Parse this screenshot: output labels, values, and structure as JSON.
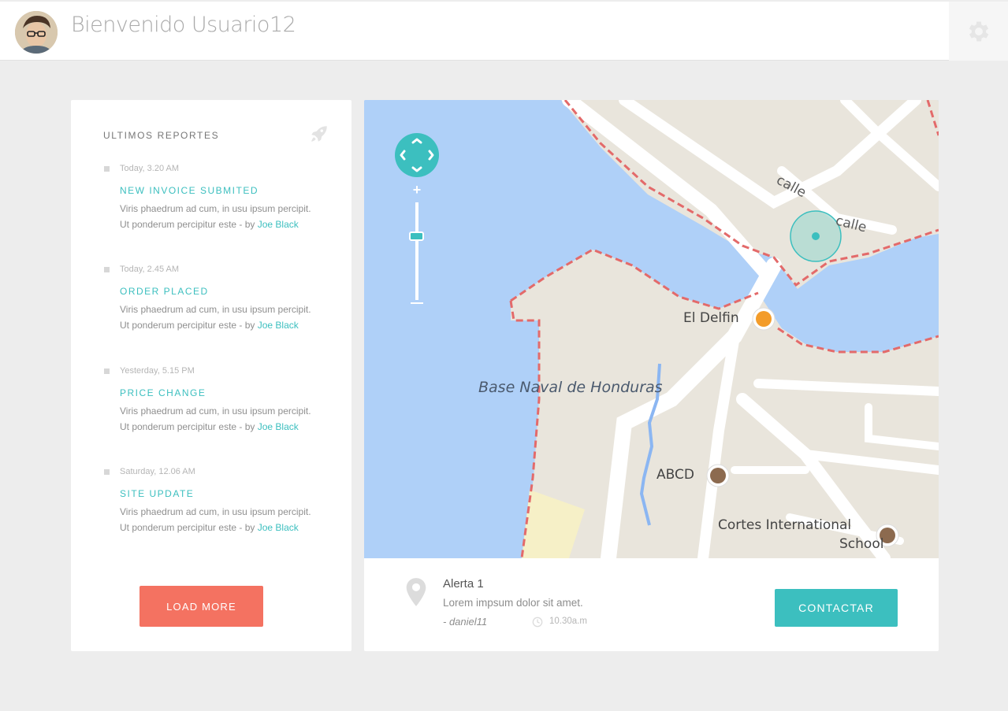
{
  "header": {
    "welcome": "Bienvenido Usuario12",
    "avatar_icon": "user-avatar",
    "settings_icon": "gear-icon"
  },
  "reports": {
    "title": "ULTIMOS REPORTES",
    "icon": "rocket-icon",
    "items": [
      {
        "time": "Today, 3.20 AM",
        "title": "NEW INVOICE SUBMITED",
        "line1": "Viris phaedrum ad cum, in usu ipsum percipit.",
        "line2": "Ut ponderum percipitur este - by ",
        "author": "Joe Black"
      },
      {
        "time": "Today, 2.45 AM",
        "title": "ORDER PLACED",
        "line1": "Viris phaedrum ad cum, in usu ipsum percipit.",
        "line2": "Ut ponderum percipitur este - by ",
        "author": "Joe Black"
      },
      {
        "time": "Yesterday, 5.15 PM",
        "title": "PRICE CHANGE",
        "line1": "Viris phaedrum ad cum, in usu ipsum percipit.",
        "line2": "Ut ponderum percipitur este - by ",
        "author": "Joe Black"
      },
      {
        "time": "Saturday, 12.06 AM",
        "title": "SITE UPDATE",
        "line1": "Viris phaedrum ad cum, in usu ipsum percipit.",
        "line2": "Ut ponderum percipitur este - by ",
        "author": "Joe Black"
      }
    ],
    "load_more": "LOAD MORE"
  },
  "map": {
    "labels": {
      "calle_1": "calle",
      "calle_2": "calle",
      "el_delfin": "El Delfin",
      "base_naval": "Base Naval de Honduras",
      "abcd": "ABCD",
      "cortes_line1": "Cortes International",
      "cortes_line2": "School"
    },
    "controls": {
      "zoom_in": "+",
      "zoom_level": 0.35
    }
  },
  "alert": {
    "title": "Alerta 1",
    "body": "Lorem impsum dolor sit amet.",
    "user": "- daniel11",
    "time": "10.30a.m",
    "button": "CONTACTAR"
  },
  "colors": {
    "accent": "#3cbfbf",
    "load_more": "#f47261",
    "water": "#afd0f8",
    "land": "#e9e5dc"
  }
}
